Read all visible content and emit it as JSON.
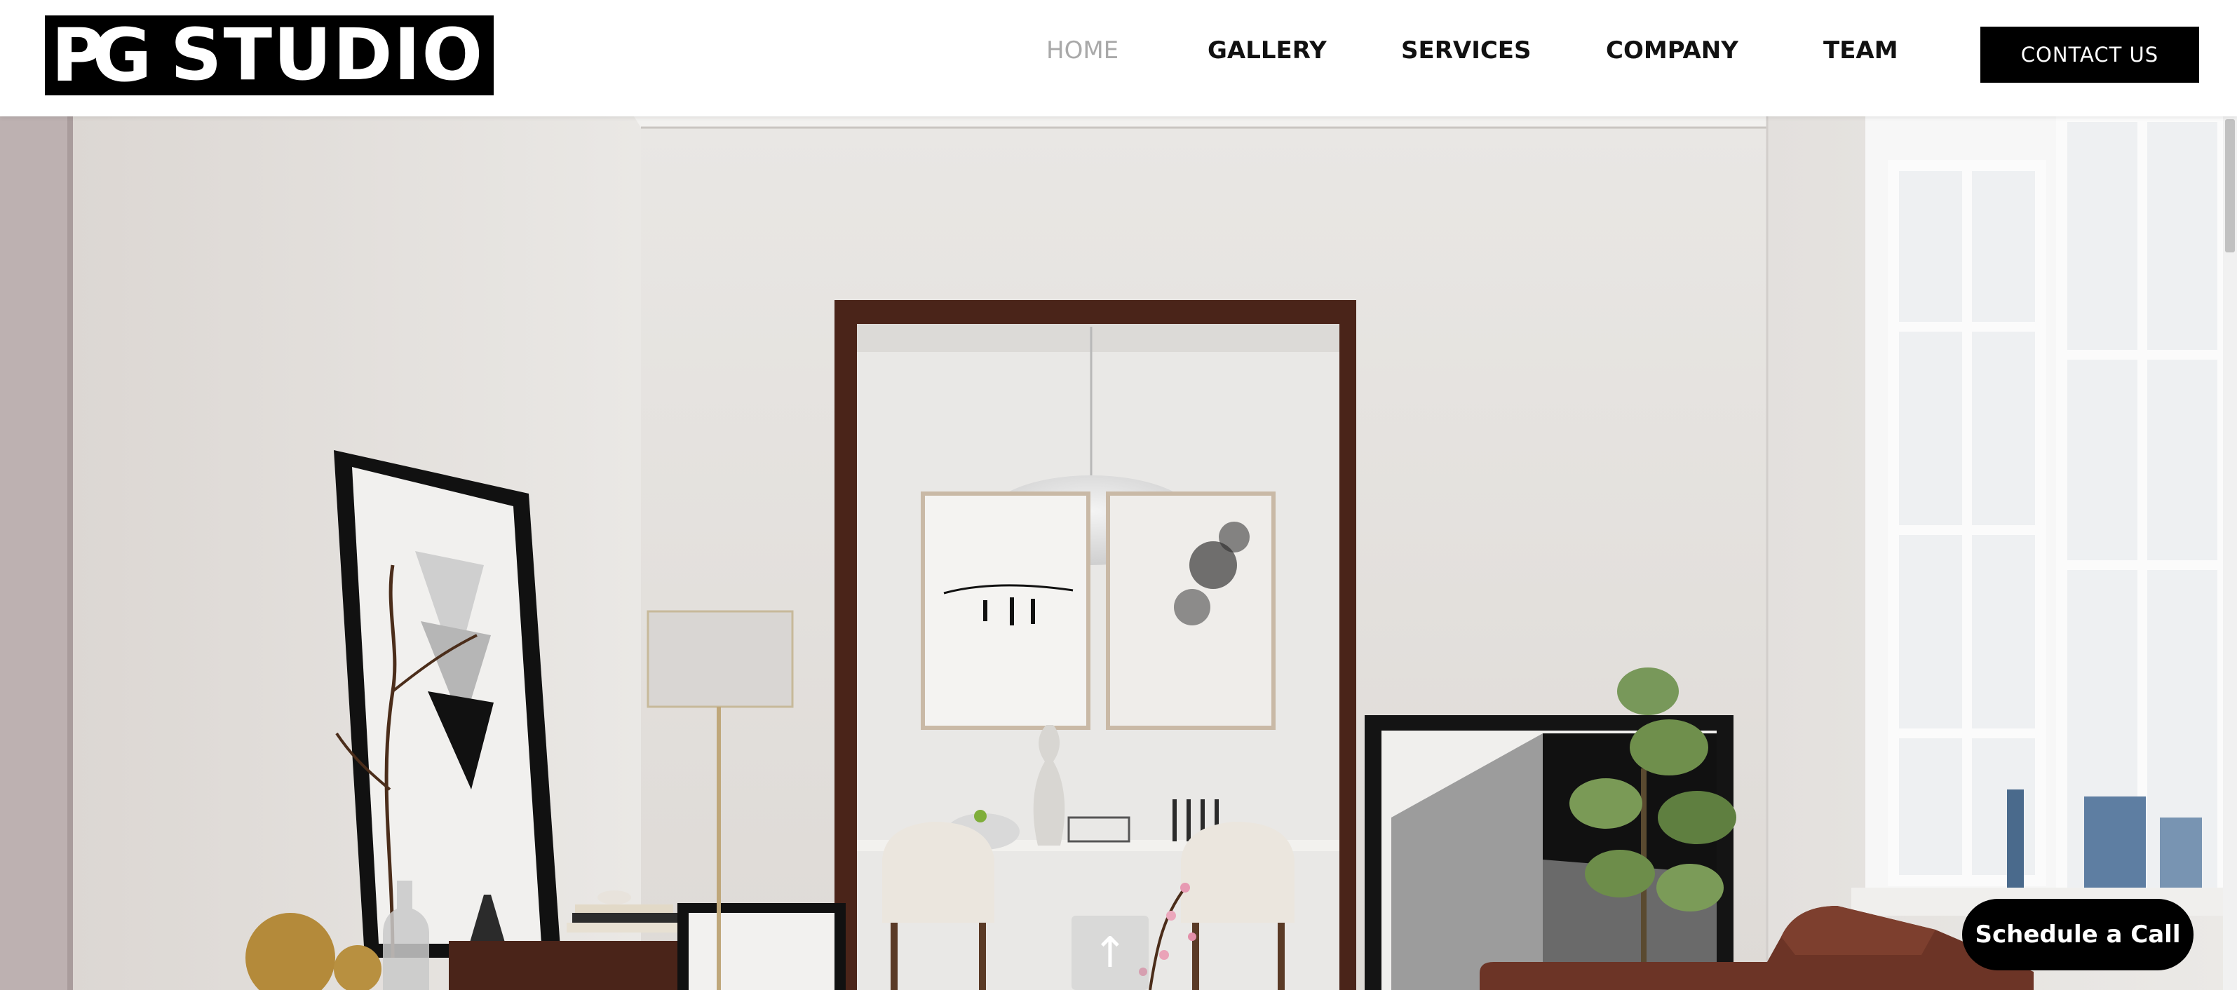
{
  "brand": {
    "logo_mark": "PG",
    "logo_text": "STUDIO"
  },
  "nav": {
    "items": [
      {
        "label": "HOME",
        "active": true
      },
      {
        "label": "GALLERY",
        "active": false
      },
      {
        "label": "SERVICES",
        "active": false
      },
      {
        "label": "COMPANY",
        "active": false
      },
      {
        "label": "TEAM",
        "active": false
      }
    ],
    "contact_label": "CONTACT US"
  },
  "floating": {
    "schedule_label": "Schedule a Call",
    "scroll_top_icon": "arrow-up-icon"
  },
  "colors": {
    "header_bg": "#ffffff",
    "brand_black": "#000000",
    "active_nav": "#a9a9a9",
    "wall": "#e7e4e1",
    "wood": "#4a2419"
  }
}
